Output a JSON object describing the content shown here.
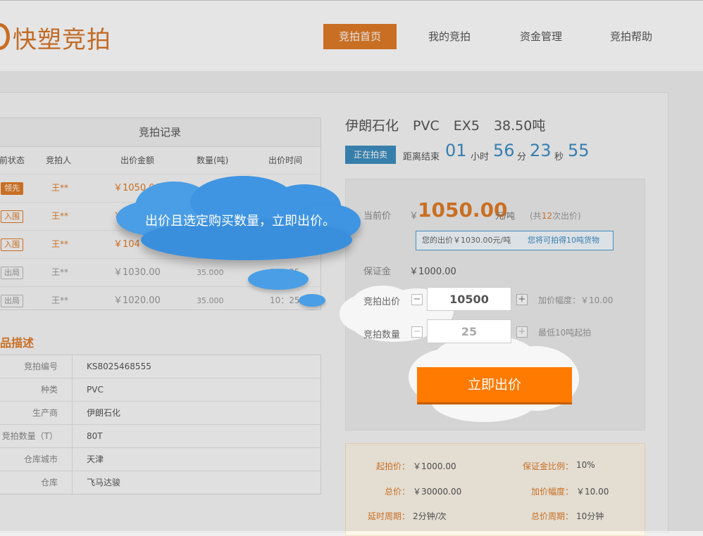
{
  "brand": {
    "name": "快塑竞拍"
  },
  "nav": [
    {
      "label": "竞拍首页",
      "active": true
    },
    {
      "label": "我的竞拍"
    },
    {
      "label": "资金管理"
    },
    {
      "label": "竞拍帮助"
    }
  ],
  "records": {
    "title": "竞拍记录",
    "columns": [
      "前状态",
      "竞拍人",
      "出价金额",
      "数量(吨)",
      "出价时间"
    ],
    "rows": [
      {
        "status": "领先",
        "bidder": "王**",
        "amount": "￥1050.00",
        "qty": "",
        "time": ""
      },
      {
        "status": "入围",
        "bidder": "王**",
        "amount": "￥",
        "qty": "",
        "time": ""
      },
      {
        "status": "入围",
        "bidder": "王**",
        "amount": "￥104",
        "qty": "",
        "time": ""
      },
      {
        "status": "出局",
        "bidder": "王**",
        "amount": "￥1030.00",
        "qty": "35.000",
        "time": "10：25"
      },
      {
        "status": "出局",
        "bidder": "王**",
        "amount": "￥1020.00",
        "qty": "35.000",
        "time": "10：25"
      }
    ]
  },
  "description": {
    "title": "品描述",
    "rows": [
      {
        "k": "竞拍编号",
        "v": "KS8025468555"
      },
      {
        "k": "种类",
        "v": "PVC"
      },
      {
        "k": "生产商",
        "v": "伊朗石化"
      },
      {
        "k": "竞拍数量（T）",
        "v": "80T"
      },
      {
        "k": "仓库城市",
        "v": "天津"
      },
      {
        "k": "仓库",
        "v": "飞马达骏"
      }
    ]
  },
  "product": {
    "title": "伊朗石化 PVC EX5 38.50吨",
    "status": "正在拍卖",
    "countdown_label": "距离结束",
    "hours": "01",
    "hours_unit": "小时",
    "minutes": "56",
    "minutes_unit": "分",
    "seconds_a": "23",
    "seconds_unit": "秒",
    "seconds_b": "55"
  },
  "bid": {
    "current_label": "当前价",
    "currency": "￥",
    "current_price": "1050.00",
    "price_unit": "元/吨",
    "bid_count_prefix": "(共",
    "bid_count": "12",
    "bid_count_suffix": "次出价)",
    "my_bid": "您的出价￥1030.00元/吨",
    "my_hint": "您将可拍得10吨货物",
    "deposit_label": "保证金",
    "deposit": "￥1000.00",
    "price_label": "竞拍出价",
    "price_value": "10500",
    "increment_text": "加价幅度：￥10.00",
    "qty_label": "竞拍数量",
    "qty_value": "25",
    "min_text": "最低10吨起拍",
    "minus": "−",
    "plus": "+",
    "submit": "立即出价"
  },
  "info": [
    {
      "k": "起拍价：",
      "v": "￥1000.00"
    },
    {
      "k": "保证金比例：",
      "v": "10%"
    },
    {
      "k": "总价：",
      "v": "￥30000.00"
    },
    {
      "k": "加价幅度：",
      "v": "￥10.00"
    },
    {
      "k": "延时周期：",
      "v": "2分钟/次"
    },
    {
      "k": "总价周期：",
      "v": "10分钟"
    }
  ],
  "tooltip": {
    "text": "出价且选定购买数量，立即出价。"
  },
  "colors": {
    "accent": "#e07c28",
    "button": "#ff7a00",
    "blue": "#3d8dc4"
  }
}
